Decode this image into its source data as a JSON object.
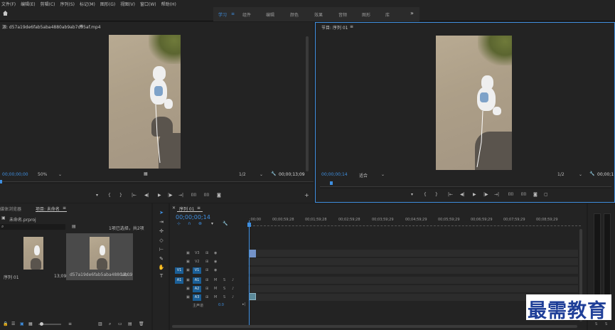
{
  "menu": [
    "文件(F)",
    "编辑(E)",
    "剪辑(C)",
    "序列(S)",
    "标记(M)",
    "图形(G)",
    "视图(V)",
    "窗口(W)",
    "帮助(H)"
  ],
  "workspaces": {
    "items": [
      {
        "label": "学习",
        "active": true
      },
      {
        "label": "组件",
        "active": false
      },
      {
        "label": "编辑",
        "active": false
      },
      {
        "label": "颜色",
        "active": false
      },
      {
        "label": "效果",
        "active": false
      },
      {
        "label": "音频",
        "active": false
      },
      {
        "label": "图形",
        "active": false
      },
      {
        "label": "库",
        "active": false
      }
    ],
    "menu_glyph": "≡",
    "more": "»"
  },
  "source": {
    "title": "源: d57a19de6fab5aba4880ab9ab7d95af.mp4",
    "menu_glyph": "≡",
    "timecode": "00;00;00;00",
    "zoom": "50%",
    "resolution": "1/2",
    "duration": "00;00;13;09"
  },
  "program": {
    "title": "节目: 序列 01",
    "menu_glyph": "≡",
    "timecode": "00;00;00;14",
    "fit": "适合",
    "resolution": "1/2",
    "duration": "00;00;1"
  },
  "transport_source": [
    "▾",
    "{",
    "}",
    "|←",
    "◀|",
    "▶",
    "|▶",
    "→|",
    "⌷⌷",
    "⌷⌷",
    "◙"
  ],
  "transport_program": [
    "▾",
    "{",
    "}",
    "|←",
    "◀|",
    "▶",
    "|▶",
    "→|",
    "⌷⌷",
    "⌷⌷",
    "◙",
    "▢"
  ],
  "project": {
    "tabs": [
      "媒体浏览器",
      "项目: 未命名"
    ],
    "menu_glyph": "≡",
    "filename": "未命名.prproj",
    "selection": "1项已选择，共2项",
    "items": [
      {
        "name": "序列 01",
        "duration": "13;09"
      },
      {
        "name": "d57a19de6fab5aba4880ab...",
        "duration": "13;09"
      }
    ]
  },
  "timeline": {
    "title": "序列 01",
    "menu_glyph": "≡",
    "timecode": "00;00;00;14",
    "ruler": [
      ";00;00",
      "00;00;59;28",
      "00;01;59;28",
      "00;02;59;28",
      "00;03;59;29",
      "00;04;59;29",
      "00;05;59;29",
      "00;06;59;29",
      "00;07;59;29",
      "00;08;59;29"
    ],
    "tracks": [
      {
        "src": "",
        "name": "V3",
        "type": "video"
      },
      {
        "src": "",
        "name": "V2",
        "type": "video"
      },
      {
        "src": "V1",
        "name": "V1",
        "type": "video"
      },
      {
        "src": "A1",
        "name": "A1",
        "type": "audio"
      },
      {
        "src": "",
        "name": "A2",
        "type": "audio"
      },
      {
        "src": "",
        "name": "A3",
        "type": "audio"
      }
    ],
    "master_label": "主声道",
    "master_value": "0.0",
    "track_glyphs": {
      "lock": "🔒",
      "eye": "👁",
      "m": "M",
      "s": "S",
      "mic": "🎤",
      "clip": "⊞"
    }
  },
  "watermark": "最需教育",
  "colors": {
    "accent": "#3f8fe0",
    "panel": "#232323",
    "clip": "#7393c9",
    "track_btn": "#1a5e96"
  }
}
